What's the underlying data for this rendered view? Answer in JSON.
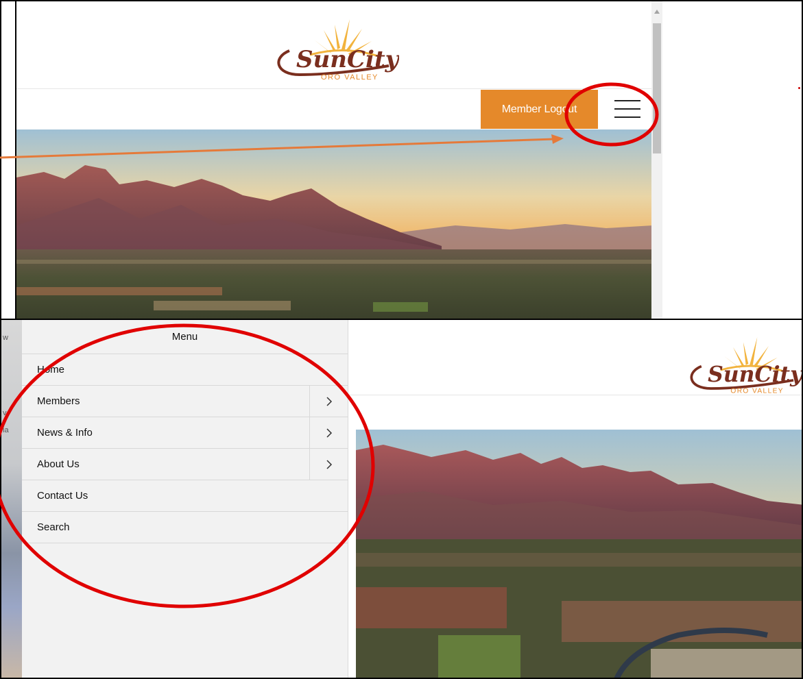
{
  "top_screenshot": {
    "logo": {
      "main": "SunCity",
      "sub": "ORO VALLEY"
    },
    "nav": {
      "member_logout_label": "Member Logout"
    },
    "icons": {
      "menu": "hamburger-menu-icon",
      "scroll": "scroll-up-arrow-icon"
    },
    "colors": {
      "accent": "#e5892a",
      "logo_brown": "#7a2e1e",
      "sun": "#f2b33d"
    }
  },
  "bottom_screenshot": {
    "menu": {
      "title": "Menu",
      "items": [
        {
          "label": "Home",
          "has_submenu": false
        },
        {
          "label": "Members",
          "has_submenu": true
        },
        {
          "label": "News & Info",
          "has_submenu": true
        },
        {
          "label": "About Us",
          "has_submenu": true
        },
        {
          "label": "Contact Us",
          "has_submenu": false
        },
        {
          "label": "Search",
          "has_submenu": false
        }
      ]
    },
    "logo": {
      "main": "SunCity",
      "sub": "ORO VALLEY"
    },
    "icons": {
      "submenu": "chevron-right-icon"
    }
  },
  "annotations": {
    "circle_color": "#e00000",
    "arrow_color": "#e57a3a"
  }
}
